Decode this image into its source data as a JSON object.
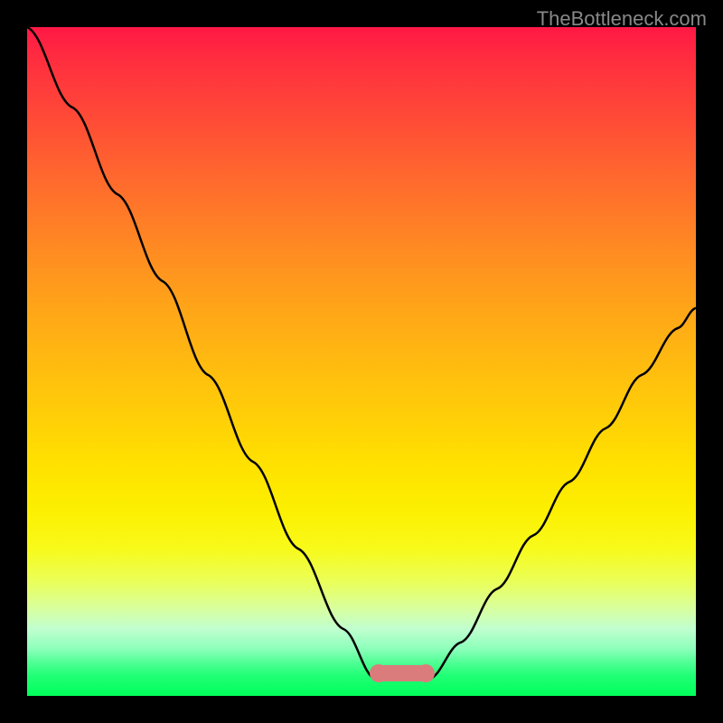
{
  "watermark": "TheBottleneck.com",
  "chart_data": {
    "type": "line",
    "title": "",
    "xlabel": "",
    "ylabel": "",
    "description": "Bottleneck curve showing percentage mismatch - V-shaped curve with minimum near center representing optimal hardware balance",
    "series": [
      {
        "name": "left-curve",
        "x": [
          0,
          50,
          100,
          150,
          200,
          250,
          300,
          350,
          385
        ],
        "y": [
          100,
          88,
          75,
          62,
          48,
          35,
          22,
          10,
          2.5
        ]
      },
      {
        "name": "right-curve",
        "x": [
          445,
          480,
          520,
          560,
          600,
          640,
          680,
          720,
          740
        ],
        "y": [
          2.5,
          8,
          16,
          24,
          32,
          40,
          48,
          55,
          58
        ]
      }
    ],
    "optimal_band": {
      "start_x": 385,
      "end_x": 445,
      "y": 2.5
    },
    "xlim": [
      0,
      740
    ],
    "ylim": [
      0,
      100
    ],
    "background_gradient": {
      "top_color": "#ff1845",
      "bottom_color": "#00ff5a"
    }
  }
}
